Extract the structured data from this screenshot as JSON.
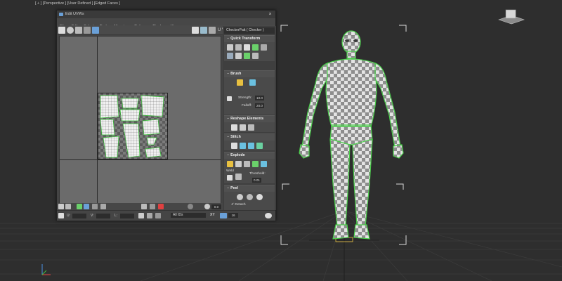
{
  "viewport": {
    "label": "[ + ] [Perspective ] [User Defined ] [Edged Faces ]"
  },
  "uv_editor": {
    "title": "Edit UVWs",
    "close": "×",
    "menu": [
      "File",
      "Edit",
      "Select",
      "Tools",
      "Mapping",
      "Options",
      "Display",
      "View"
    ],
    "toolbar_uv": "U V",
    "checker_label": "CheckerPatt   ( Checker )",
    "sections": {
      "quick_transform": "Quick Transform",
      "brush": "Brush",
      "reshape": "Reshape Elements",
      "stitch": "Stitch",
      "explode": "Explode",
      "peel": "Peel"
    },
    "brush": {
      "strength_label": "Strength:",
      "strength_value": "10.0",
      "falloff_label": "Falloff:",
      "falloff_value": "20.0"
    },
    "explode": {
      "weld_label": "Weld",
      "threshold_label": "Threshold:",
      "threshold_value": "0.01"
    },
    "peel": {
      "detach_label": "Detach"
    },
    "bottom": {
      "u_label": "U:",
      "v_label": "V:",
      "l_label": "L:",
      "zoom_value": "0.0",
      "xy_label": "XY",
      "grid_value": "16",
      "selection_dropdown": "All IDs"
    }
  }
}
